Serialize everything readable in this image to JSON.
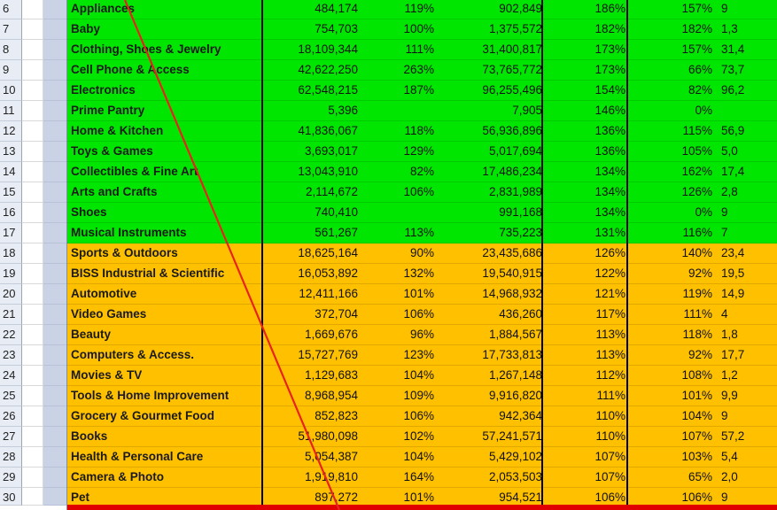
{
  "rows": [
    {
      "num": "6",
      "category": "Appliances",
      "v1": "484,174",
      "p1": "119%",
      "v2": "902,849",
      "p2": "186%",
      "p3": "157%",
      "v3": "9",
      "band": "green"
    },
    {
      "num": "7",
      "category": "Baby",
      "v1": "754,703",
      "p1": "100%",
      "v2": "1,375,572",
      "p2": "182%",
      "p3": "182%",
      "v3": "1,3",
      "band": "green"
    },
    {
      "num": "8",
      "category": "Clothing, Shoes & Jewelry",
      "v1": "18,109,344",
      "p1": "111%",
      "v2": "31,400,817",
      "p2": "173%",
      "p3": "157%",
      "v3": "31,4",
      "band": "green"
    },
    {
      "num": "9",
      "category": "Cell Phone & Access",
      "v1": "42,622,250",
      "p1": "263%",
      "v2": "73,765,772",
      "p2": "173%",
      "p3": "66%",
      "v3": "73,7",
      "band": "green"
    },
    {
      "num": "10",
      "category": "Electronics",
      "v1": "62,548,215",
      "p1": "187%",
      "v2": "96,255,496",
      "p2": "154%",
      "p3": "82%",
      "v3": "96,2",
      "band": "green"
    },
    {
      "num": "11",
      "category": "Prime Pantry",
      "v1": "5,396",
      "p1": "",
      "v2": "7,905",
      "p2": "146%",
      "p3": "0%",
      "v3": "",
      "band": "green"
    },
    {
      "num": "12",
      "category": "Home & Kitchen",
      "v1": "41,836,067",
      "p1": "118%",
      "v2": "56,936,896",
      "p2": "136%",
      "p3": "115%",
      "v3": "56,9",
      "band": "green"
    },
    {
      "num": "13",
      "category": "Toys & Games",
      "v1": "3,693,017",
      "p1": "129%",
      "v2": "5,017,694",
      "p2": "136%",
      "p3": "105%",
      "v3": "5,0",
      "band": "green"
    },
    {
      "num": "14",
      "category": "Collectibles & Fine Art",
      "v1": "13,043,910",
      "p1": "82%",
      "v2": "17,486,234",
      "p2": "134%",
      "p3": "162%",
      "v3": "17,4",
      "band": "green"
    },
    {
      "num": "15",
      "category": "Arts and Crafts",
      "v1": "2,114,672",
      "p1": "106%",
      "v2": "2,831,989",
      "p2": "134%",
      "p3": "126%",
      "v3": "2,8",
      "band": "green"
    },
    {
      "num": "16",
      "category": "Shoes",
      "v1": "740,410",
      "p1": "",
      "v2": "991,168",
      "p2": "134%",
      "p3": "0%",
      "v3": "9",
      "band": "green"
    },
    {
      "num": "17",
      "category": "Musical Instruments",
      "v1": "561,267",
      "p1": "113%",
      "v2": "735,223",
      "p2": "131%",
      "p3": "116%",
      "v3": "7",
      "band": "green"
    },
    {
      "num": "18",
      "category": "Sports & Outdoors",
      "v1": "18,625,164",
      "p1": "90%",
      "v2": "23,435,686",
      "p2": "126%",
      "p3": "140%",
      "v3": "23,4",
      "band": "orange"
    },
    {
      "num": "19",
      "category": "BISS Industrial & Scientific",
      "v1": "16,053,892",
      "p1": "132%",
      "v2": "19,540,915",
      "p2": "122%",
      "p3": "92%",
      "v3": "19,5",
      "band": "orange"
    },
    {
      "num": "20",
      "category": "Automotive",
      "v1": "12,411,166",
      "p1": "101%",
      "v2": "14,968,932",
      "p2": "121%",
      "p3": "119%",
      "v3": "14,9",
      "band": "orange"
    },
    {
      "num": "21",
      "category": "Video Games",
      "v1": "372,704",
      "p1": "106%",
      "v2": "436,260",
      "p2": "117%",
      "p3": "111%",
      "v3": "4",
      "band": "orange"
    },
    {
      "num": "22",
      "category": "Beauty",
      "v1": "1,669,676",
      "p1": "96%",
      "v2": "1,884,567",
      "p2": "113%",
      "p3": "118%",
      "v3": "1,8",
      "band": "orange"
    },
    {
      "num": "23",
      "category": "Computers & Access.",
      "v1": "15,727,769",
      "p1": "123%",
      "v2": "17,733,813",
      "p2": "113%",
      "p3": "92%",
      "v3": "17,7",
      "band": "orange"
    },
    {
      "num": "24",
      "category": "Movies & TV",
      "v1": "1,129,683",
      "p1": "104%",
      "v2": "1,267,148",
      "p2": "112%",
      "p3": "108%",
      "v3": "1,2",
      "band": "orange"
    },
    {
      "num": "25",
      "category": "Tools & Home Improvement",
      "v1": "8,968,954",
      "p1": "109%",
      "v2": "9,916,820",
      "p2": "111%",
      "p3": "101%",
      "v3": "9,9",
      "band": "orange"
    },
    {
      "num": "26",
      "category": "Grocery & Gourmet Food",
      "v1": "852,823",
      "p1": "106%",
      "v2": "942,364",
      "p2": "110%",
      "p3": "104%",
      "v3": "9",
      "band": "orange"
    },
    {
      "num": "27",
      "category": "Books",
      "v1": "51,980,098",
      "p1": "102%",
      "v2": "57,241,571",
      "p2": "110%",
      "p3": "107%",
      "v3": "57,2",
      "band": "orange"
    },
    {
      "num": "28",
      "category": "Health & Personal Care",
      "v1": "5,054,387",
      "p1": "104%",
      "v2": "5,429,102",
      "p2": "107%",
      "p3": "103%",
      "v3": "5,4",
      "band": "orange"
    },
    {
      "num": "29",
      "category": "Camera & Photo",
      "v1": "1,919,810",
      "p1": "164%",
      "v2": "2,053,503",
      "p2": "107%",
      "p3": "65%",
      "v3": "2,0",
      "band": "orange"
    },
    {
      "num": "30",
      "category": "Pet",
      "v1": "897,272",
      "p1": "101%",
      "v2": "954,521",
      "p2": "106%",
      "p3": "106%",
      "v3": "9",
      "band": "orange"
    }
  ],
  "colors": {
    "green_band": "#00e600",
    "orange_band": "#ffc000",
    "strike_line": "#e8231f",
    "bottom_bar": "#e00000"
  }
}
